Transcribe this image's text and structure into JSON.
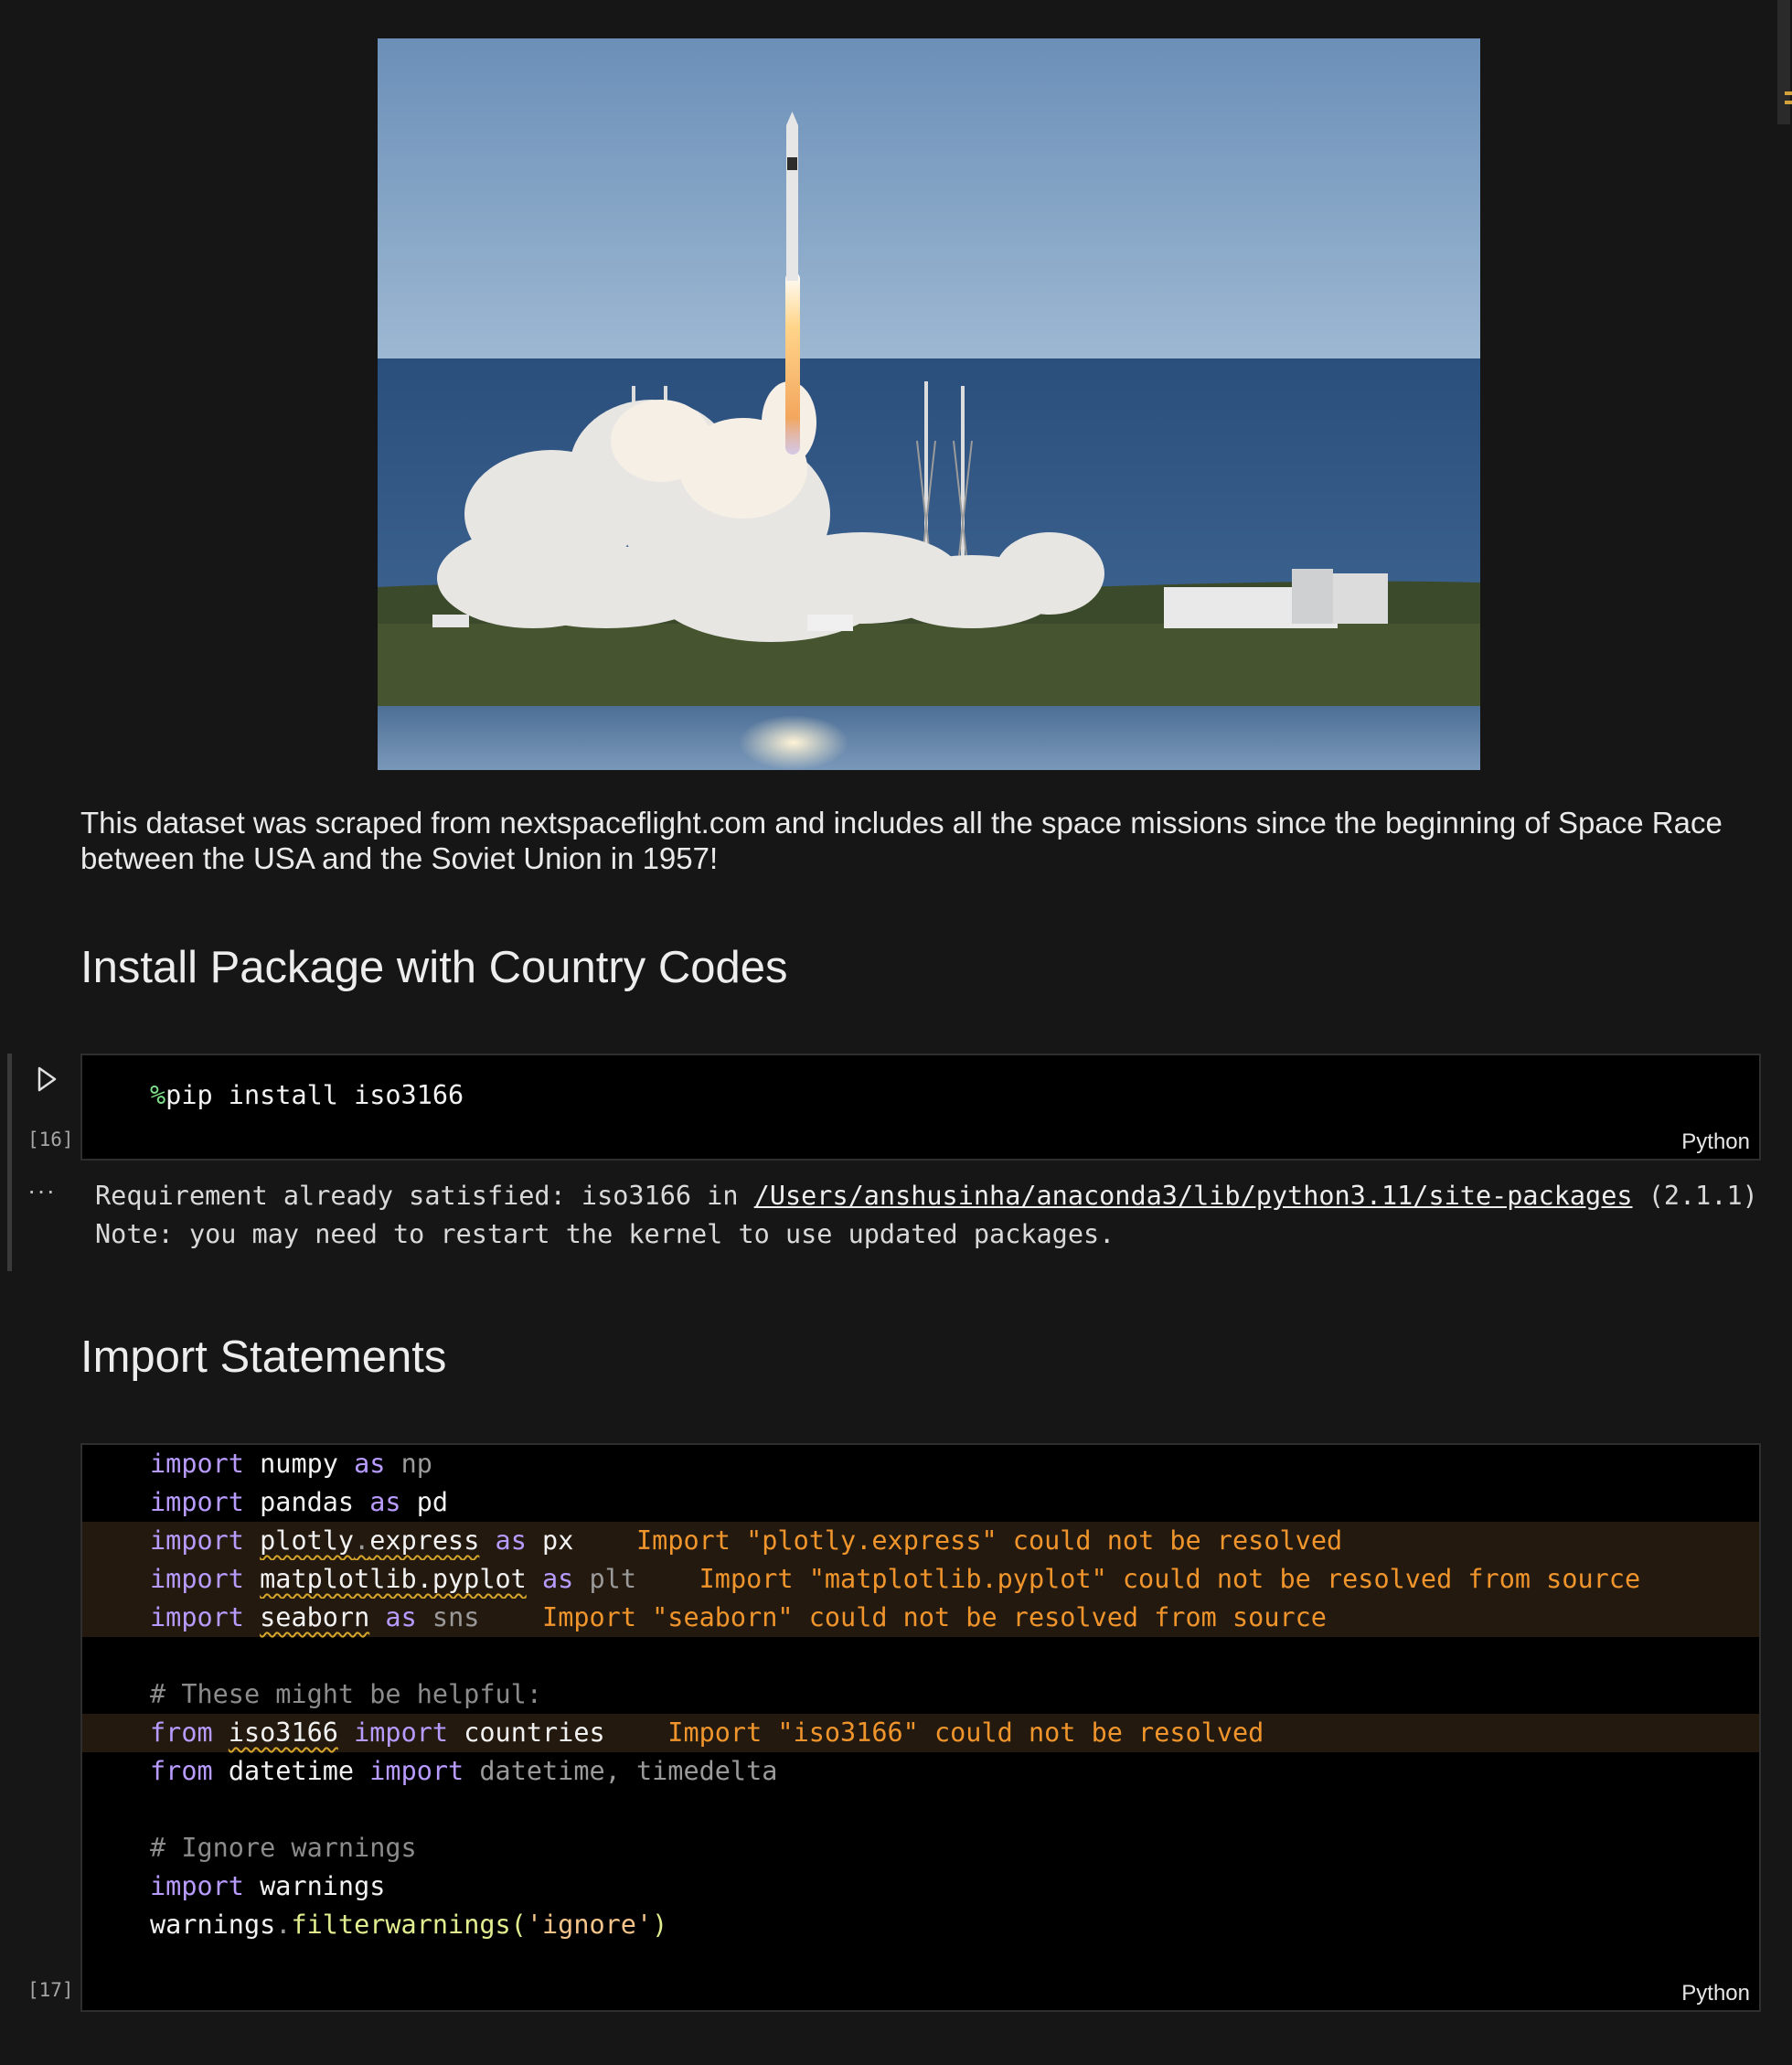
{
  "image": {
    "alt": "rocket-launch-photo"
  },
  "intro": {
    "text": "This dataset was scraped from nextspaceflight.com and includes all the space missions since the beginning of Space Race between the USA and the Soviet Union in 1957!"
  },
  "headings": {
    "install": "Install Package with Country Codes",
    "imports": "Import Statements"
  },
  "cell16": {
    "count": "[16]",
    "language": "Python",
    "code": {
      "magic": "%",
      "rest": "pip install iso3166"
    },
    "output": {
      "more": "···",
      "line1_prefix": "Requirement already satisfied: iso3166 in ",
      "line1_path": "/Users/anshusinha/anaconda3/lib/python3.11/site-packages",
      "line1_suffix": " (2.1.1)",
      "line2": "Note: you may need to restart the kernel to use updated packages."
    }
  },
  "cell17": {
    "count": "[17]",
    "language": "Python",
    "lines": {
      "l1": {
        "kw": "import",
        "mod": "numpy",
        "as": "as",
        "alias": "np"
      },
      "l2": {
        "kw": "import",
        "mod": "pandas",
        "as": "as",
        "alias": "pd"
      },
      "l3": {
        "kw": "import",
        "mod_a": "plotly",
        "mod_dot": ".",
        "mod_b": "express",
        "as": "as",
        "alias": "px",
        "warning": "Import \"plotly.express\" could not be resolved"
      },
      "l4": {
        "kw": "import",
        "mod": "matplotlib.pyplot",
        "as": "as",
        "alias": "plt",
        "warning": "Import \"matplotlib.pyplot\" could not be resolved from source"
      },
      "l5": {
        "kw": "import",
        "mod": "seaborn",
        "as": "as",
        "alias": "sns",
        "warning": "Import \"seaborn\" could not be resolved from source"
      },
      "l7": {
        "comment": "# These might be helpful:"
      },
      "l8": {
        "kw": "from",
        "mod": "iso3166",
        "kw2": "import",
        "name": "countries",
        "warning": "Import \"iso3166\" could not be resolved"
      },
      "l9": {
        "kw": "from",
        "mod": "datetime",
        "kw2": "import",
        "names": "datetime, timedelta"
      },
      "l11": {
        "comment": "# Ignore warnings"
      },
      "l12": {
        "kw": "import",
        "mod": "warnings"
      },
      "l13": {
        "obj": "warnings",
        "dot": ".",
        "fn": "filterwarnings",
        "open": "(",
        "arg": "'ignore'",
        "close": ")"
      }
    }
  },
  "colors": {
    "background": "#161616",
    "code_background": "#000000",
    "keyword": "#b89bff",
    "warning": "#f0952c",
    "function": "#e2ed8f",
    "string": "#f4c48a"
  }
}
